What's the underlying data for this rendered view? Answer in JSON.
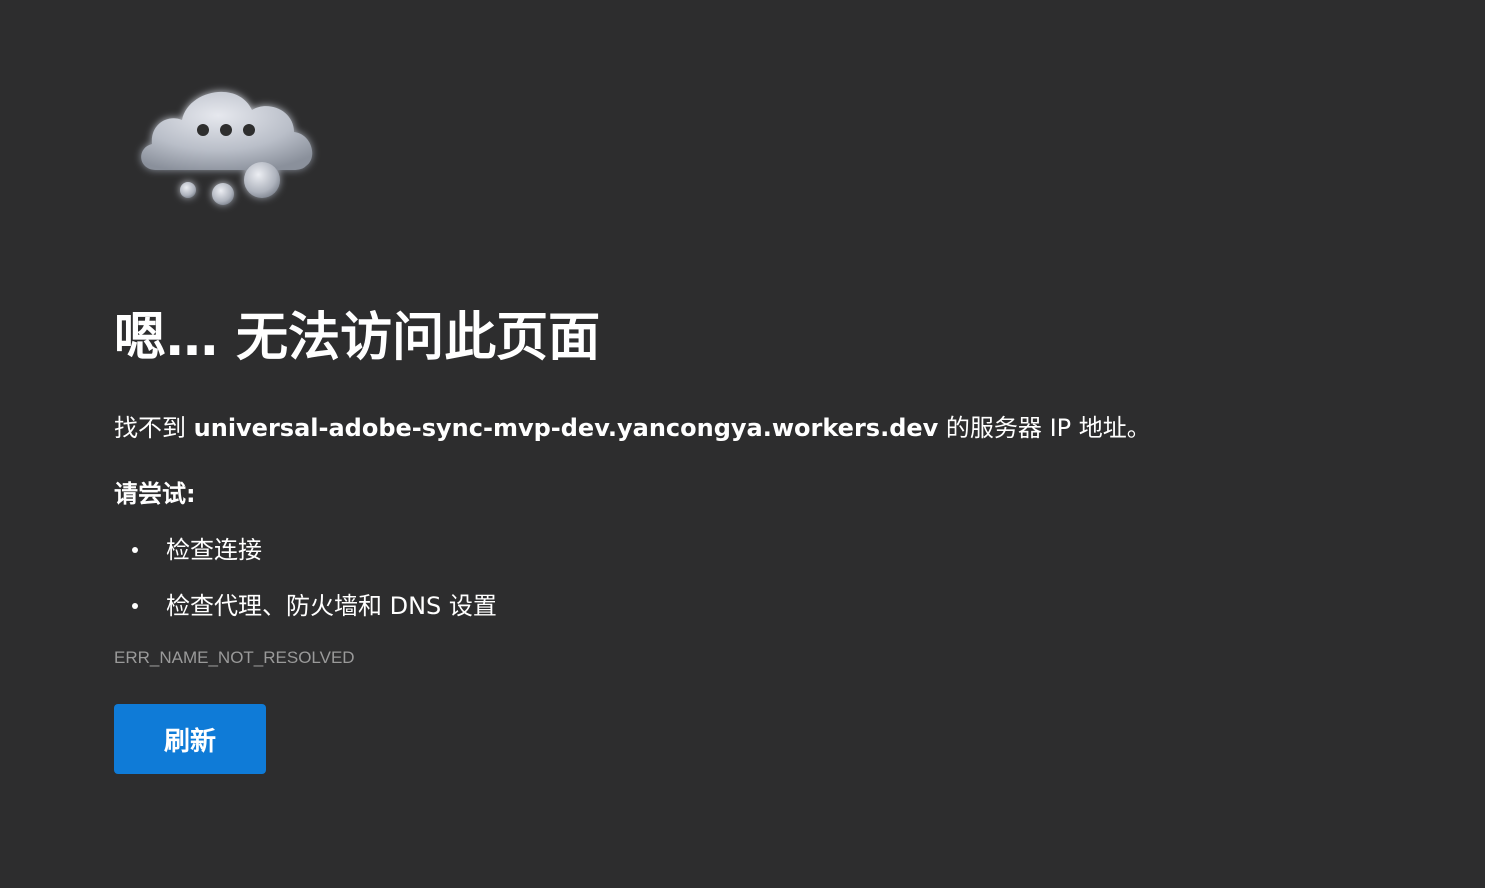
{
  "illustration": {
    "icon": "thinking-cloud-icon"
  },
  "error": {
    "title": "嗯… 无法访问此页面",
    "message_prefix": "找不到 ",
    "host": "universal-adobe-sync-mvp-dev.yancongya.workers.dev",
    "message_middle": " 的服务器 ",
    "ip_label": "IP",
    "message_suffix": " 地址。",
    "try_label": "请尝试:",
    "suggestions": [
      "检查连接",
      "检查代理、防火墙和 DNS 设置"
    ],
    "code": "ERR_NAME_NOT_RESOLVED"
  },
  "actions": {
    "refresh_label": "刷新"
  },
  "colors": {
    "background": "#2d2d2e",
    "accent": "#0f7bd7",
    "muted_text": "#9a9a9a"
  }
}
